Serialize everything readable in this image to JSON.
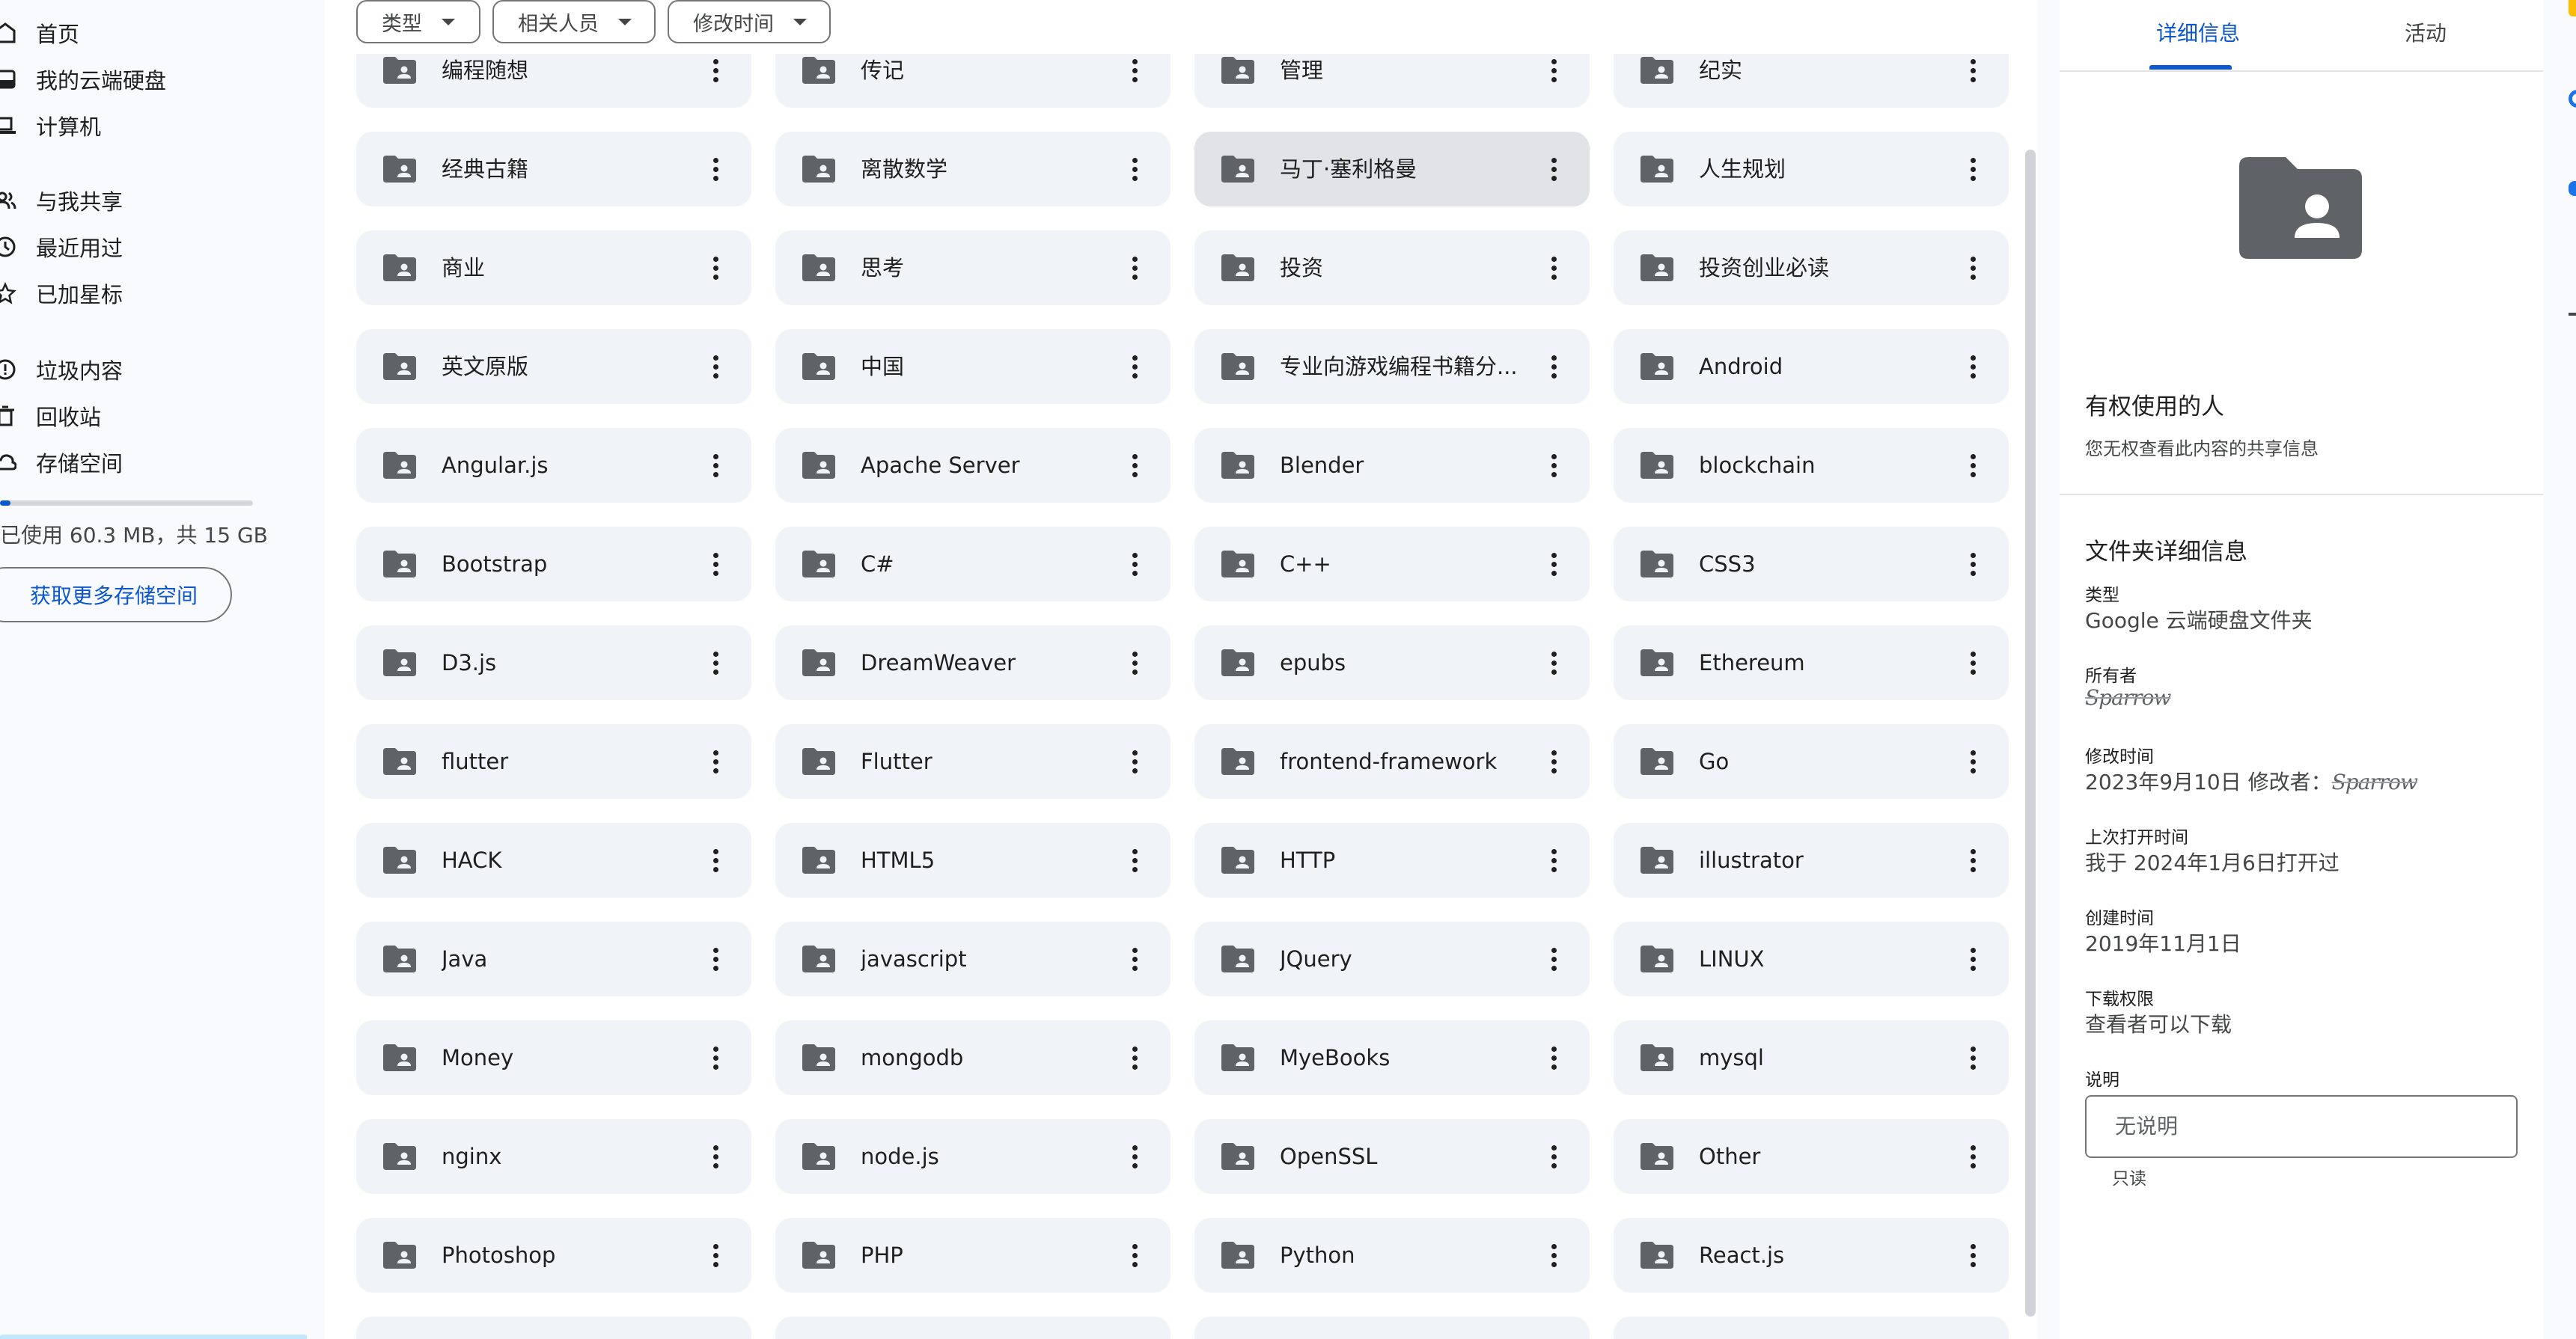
{
  "sidebar": {
    "items": [
      {
        "label": "首页",
        "icon": "home-icon"
      },
      {
        "label": "我的云端硬盘",
        "icon": "drive-icon"
      },
      {
        "label": "计算机",
        "icon": "computer-icon"
      },
      {
        "label": "与我共享",
        "icon": "shared-icon"
      },
      {
        "label": "最近用过",
        "icon": "clock-icon"
      },
      {
        "label": "已加星标",
        "icon": "star-icon"
      },
      {
        "label": "垃圾内容",
        "icon": "spam-icon"
      },
      {
        "label": "回收站",
        "icon": "trash-icon"
      },
      {
        "label": "存储空间",
        "icon": "cloud-icon"
      }
    ],
    "storage_text": "已使用 60.3 MB，共 15 GB",
    "storage_used_fraction": 0.004,
    "get_storage_label": "获取更多存储空间"
  },
  "filters": {
    "type_label": "类型",
    "people_label": "相关人员",
    "modified_label": "修改时间"
  },
  "folders": [
    "编程随想",
    "传记",
    "管理",
    "纪实",
    "经典古籍",
    "离散数学",
    "马丁·塞利格曼",
    "人生规划",
    "商业",
    "思考",
    "投资",
    "投资创业必读",
    "英文原版",
    "中国",
    "专业向游戏编程书籍分...",
    "Android",
    "Angular.js",
    "Apache Server",
    "Blender",
    "blockchain",
    "Bootstrap",
    "C#",
    "C++",
    "CSS3",
    "D3.js",
    "DreamWeaver",
    "epubs",
    "Ethereum",
    "flutter",
    "Flutter",
    "frontend-framework",
    "Go",
    "HACK",
    "HTML5",
    "HTTP",
    "illustrator",
    "Java",
    "javascript",
    "JQuery",
    "LINUX",
    "Money",
    "mongodb",
    "MyeBooks",
    "mysql",
    "nginx",
    "node.js",
    "OpenSSL",
    "Other",
    "Photoshop",
    "PHP",
    "Python",
    "React.js"
  ],
  "selected_folder": "马丁·塞利格曼",
  "details": {
    "tab_details": "详细信息",
    "tab_activity": "活动",
    "access_heading": "有权使用的人",
    "access_sub": "您无权查看此内容的共享信息",
    "folder_details_heading": "文件夹详细信息",
    "type_label": "类型",
    "type_value": "Google 云端硬盘文件夹",
    "owner_label": "所有者",
    "owner_value": "Sparrow",
    "modified_label": "修改时间",
    "modified_value": "2023年9月10日 修改者：",
    "modified_by": "Sparrow",
    "opened_label": "上次打开时间",
    "opened_value": "我于 2024年1月6日打开过",
    "created_label": "创建时间",
    "created_value": "2019年11月1日",
    "download_label": "下载权限",
    "download_value": "查看者可以下载",
    "description_label": "说明",
    "description_placeholder": "无说明",
    "description_readonly": "只读"
  },
  "colors": {
    "accent": "#0b57d0",
    "card_bg": "#f0f4f9",
    "card_selected": "#e1e3e6",
    "folder_icon": "#5f6368"
  }
}
